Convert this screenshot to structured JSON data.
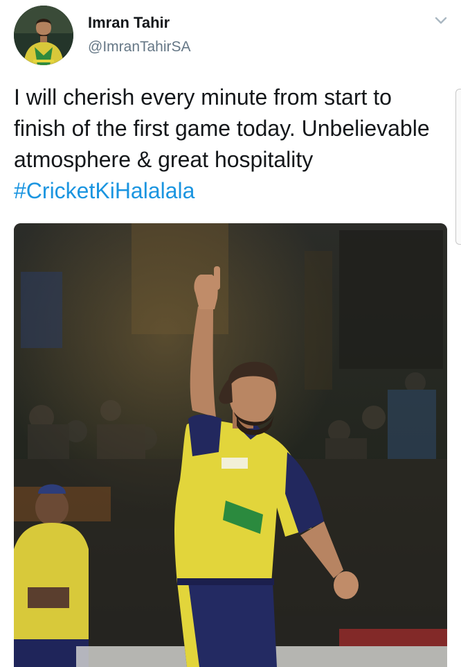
{
  "tweet": {
    "author": {
      "display_name": "Imran Tahir",
      "handle": "@ImranTahirSA",
      "avatar_icon": "profile-photo-icon"
    },
    "menu_icon": "chevron-down-icon",
    "text_before_hashtag": "I will cherish every minute from start to finish of the first game today. Unbelievable atmosphere & great hospitality ",
    "hashtag": "#CricketKiHalalala",
    "media_icon": "photo-icon"
  },
  "colors": {
    "text": "#14171a",
    "secondary": "#657786",
    "link": "#1b95e0",
    "jersey_yellow": "#e7d63a",
    "jersey_navy": "#20265a"
  }
}
